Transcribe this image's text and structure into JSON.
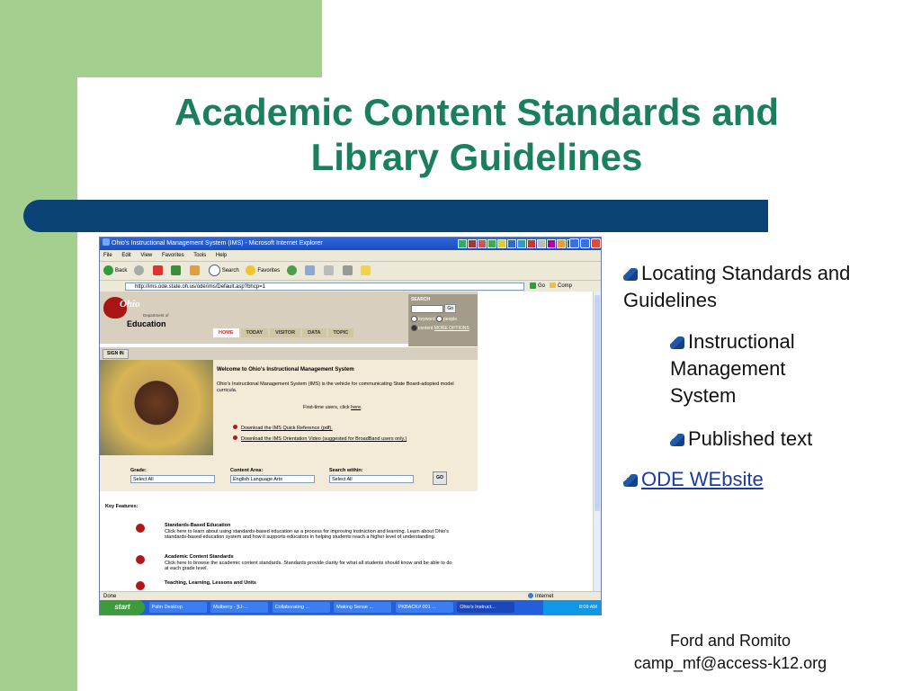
{
  "slide": {
    "title_line1": "Academic Content Standards and",
    "title_line2": "Library Guidelines",
    "bullets": {
      "locating": "Locating Standards and Guidelines",
      "ims": "Instructional Management System",
      "published": "Published text",
      "ode": "ODE WEbsite"
    },
    "footer_name": "Ford and Romito",
    "footer_email": "camp_mf@access-k12.org",
    "colors": {
      "green": "#a4cf8f",
      "title": "#1b7f5b",
      "bar": "#0a4275"
    }
  },
  "browser": {
    "window_title": "Ohio's Instructional Management System (IMS) - Microsoft Internet Explorer",
    "menu": [
      "File",
      "Edit",
      "View",
      "Favorites",
      "Tools",
      "Help"
    ],
    "toolbar": {
      "back": "Back",
      "search": "Search",
      "favorites": "Favorites"
    },
    "address_url": "http://ims.ode.state.oh.us/ode/ims/Default.asp?bhcp=1",
    "go": "Go",
    "comp": "Comp",
    "status_left": "Done",
    "status_right": "Internet"
  },
  "ims": {
    "logo_text": "Ohio",
    "dept_text": "Department of",
    "education": "Education",
    "tabs": [
      "HOME",
      "TODAY",
      "VISITOR",
      "DATA",
      "TOPIC"
    ],
    "search": {
      "label": "SEARCH",
      "go": "Go",
      "keyword": "keyword",
      "people": "people",
      "content": "content",
      "more": "MORE OPTIONS"
    },
    "sign_in": "SIGN IN",
    "welcome_title": "Welcome to Ohio's Instructional Management System",
    "welcome_body": "Ohio's Instructional Management System (IMS) is the vehicle for communicating State Board-adopted model curricula.",
    "first_time_pre": "First-time users, click",
    "first_time_link": "here",
    "link1": "Download the IMS Quick Reference (pdf).",
    "link2": "Download the IMS Orientation Video (suggested for BroadBand users only.)",
    "filters": {
      "grade_label": "Grade:",
      "grade_value": "Select All",
      "area_label": "Content Area:",
      "area_value": "English Language Arts",
      "within_label": "Search within:",
      "within_value": "Select All",
      "go": "GO"
    },
    "key_features": "Key Features:",
    "features": [
      {
        "title": "Standards-Based Education",
        "text": "Click here to learn about using standards-based education as a process for improving instruction and learning. Learn about Ohio's standards-based education system and how it supports educators in helping students reach a higher level of understanding."
      },
      {
        "title": "Academic Content Standards",
        "text": "Click here to browse the academic content standards. Standards provide clarity for what all students should know and be able to do at each grade level."
      },
      {
        "title": "Teaching, Learning, Lessons and Units",
        "text": ""
      }
    ]
  },
  "taskbar": {
    "start": "start",
    "tasks": [
      "Palm Desktop",
      "Mulberry - [LI-...",
      "Collaborating ...",
      "Making Sense ...",
      "PKBACK# 001 ...",
      "Ohio's Instruct..."
    ],
    "clock": "8:09 AM"
  }
}
